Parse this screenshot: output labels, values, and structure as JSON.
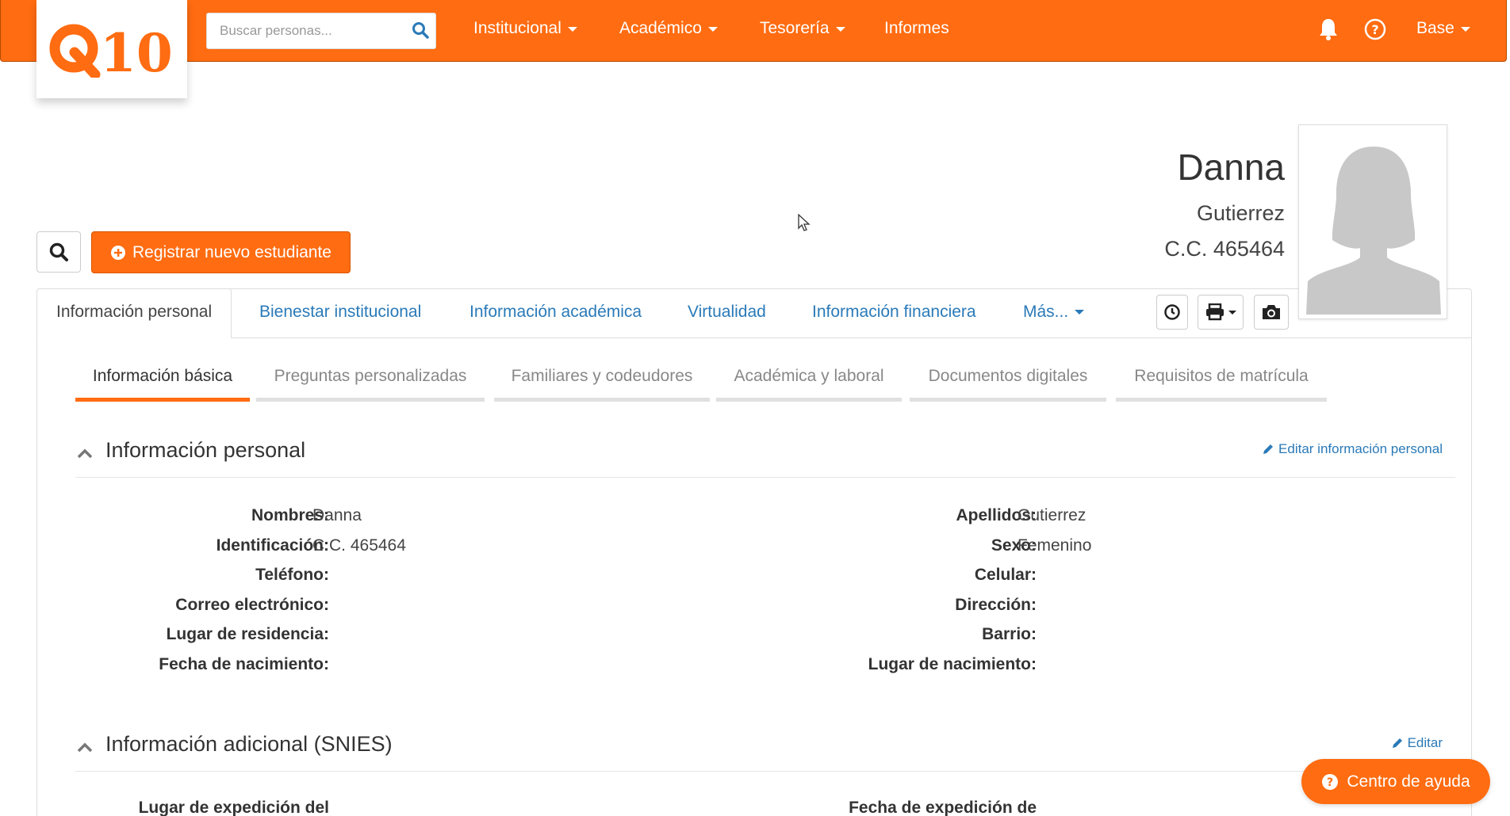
{
  "brand": {
    "logo_text": "Q10",
    "accent": "#ff6c11",
    "link": "#2a7ab8"
  },
  "navbar": {
    "search_placeholder": "Buscar personas...",
    "menu": [
      "Institucional",
      "Académico",
      "Tesorería",
      "Informes"
    ],
    "user_menu": "Base"
  },
  "profile": {
    "first_name": "Danna",
    "last_name": "Gutierrez",
    "id": "C.C. 465464"
  },
  "actions": {
    "register": "Registrar nuevo estudiante"
  },
  "tabs": [
    "Información personal",
    "Bienestar institucional",
    "Información académica",
    "Virtualidad",
    "Información financiera",
    "Más..."
  ],
  "subtabs": [
    "Información básica",
    "Preguntas personalizadas",
    "Familiares y codeudores",
    "Académica y laboral",
    "Documentos digitales",
    "Requisitos de matrícula"
  ],
  "personal": {
    "title": "Información personal",
    "edit": "Editar información personal",
    "left": [
      {
        "label": "Nombres:",
        "value": "Danna"
      },
      {
        "label": "Identificación:",
        "value": "C.C. 465464"
      },
      {
        "label": "Teléfono:",
        "value": ""
      },
      {
        "label": "Correo electrónico:",
        "value": ""
      },
      {
        "label": "Lugar de residencia:",
        "value": ""
      },
      {
        "label": "Fecha de nacimiento:",
        "value": ""
      }
    ],
    "right": [
      {
        "label": "Apellidos:",
        "value": "Gutierrez"
      },
      {
        "label": "Sexo:",
        "value": "Femenino"
      },
      {
        "label": "Celular:",
        "value": ""
      },
      {
        "label": "Dirección:",
        "value": ""
      },
      {
        "label": "Barrio:",
        "value": ""
      },
      {
        "label": "Lugar de nacimiento:",
        "value": ""
      }
    ]
  },
  "snies": {
    "title": "Información adicional (SNIES)",
    "edit": "Editar",
    "left_label": "Lugar de expedición del",
    "right_label": "Fecha de expedición de"
  },
  "help": {
    "label": "Centro de ayuda"
  }
}
